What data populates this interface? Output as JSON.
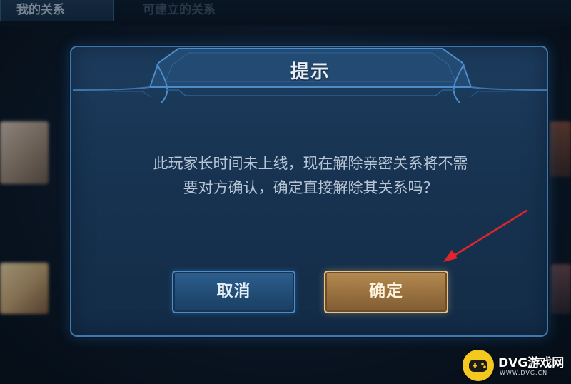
{
  "background": {
    "tabs": [
      {
        "label": "我的关系"
      },
      {
        "label": "可建立的关系"
      }
    ]
  },
  "dialog": {
    "title": "提示",
    "message_lines": [
      "此玩家长时间未上线，现在解除亲密关系将不需",
      "要对方确认，确定直接解除其关系吗？"
    ],
    "buttons": {
      "cancel_label": "取消",
      "confirm_label": "确定"
    }
  },
  "colors": {
    "dialog_border": "#3e78ad",
    "confirm_gold": "#e6c588",
    "annotation_arrow": "#e0252c"
  },
  "watermark": {
    "text": "DVG游戏网",
    "url": "WWW.DVG.CN"
  }
}
